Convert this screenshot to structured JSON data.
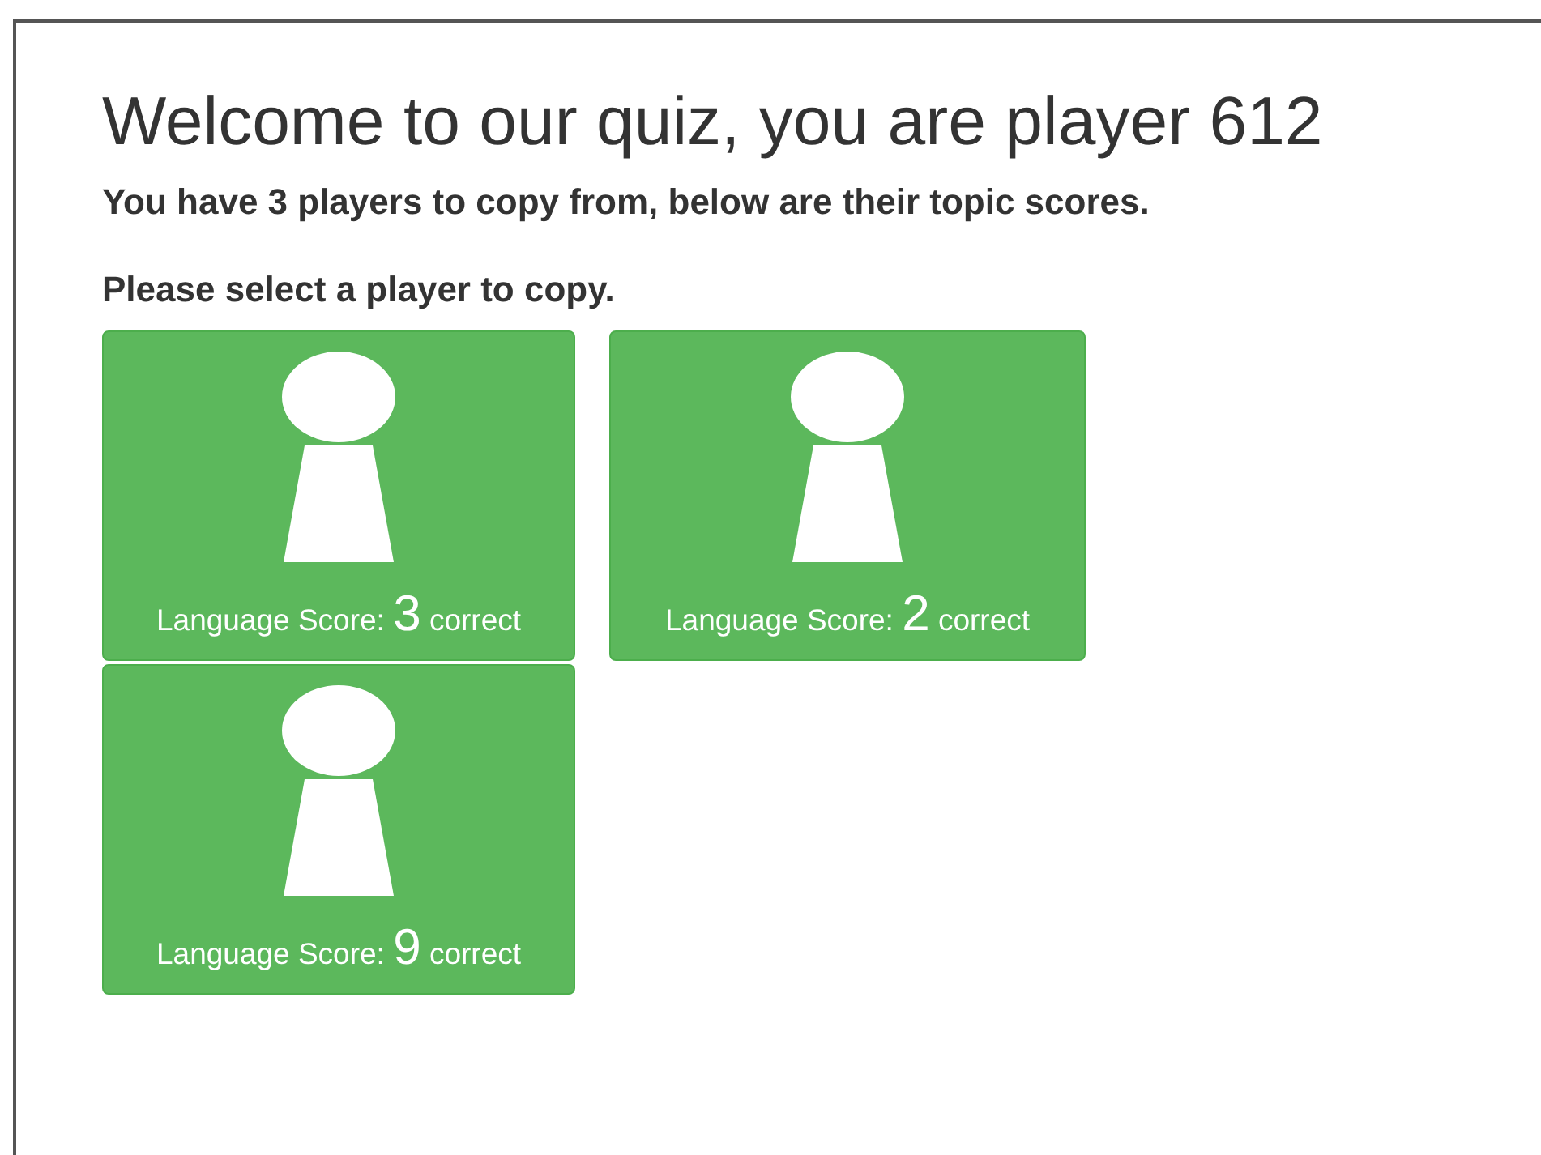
{
  "title": "Welcome to our quiz, you are player 612",
  "subtitle": "You have 3 players to copy from, below are their topic scores.",
  "prompt": "Please select a player to copy.",
  "players": [
    {
      "label": "Language Score:",
      "score": "3",
      "unit": "correct"
    },
    {
      "label": "Language Score:",
      "score": "2",
      "unit": "correct"
    },
    {
      "label": "Language Score:",
      "score": "9",
      "unit": "correct"
    }
  ]
}
